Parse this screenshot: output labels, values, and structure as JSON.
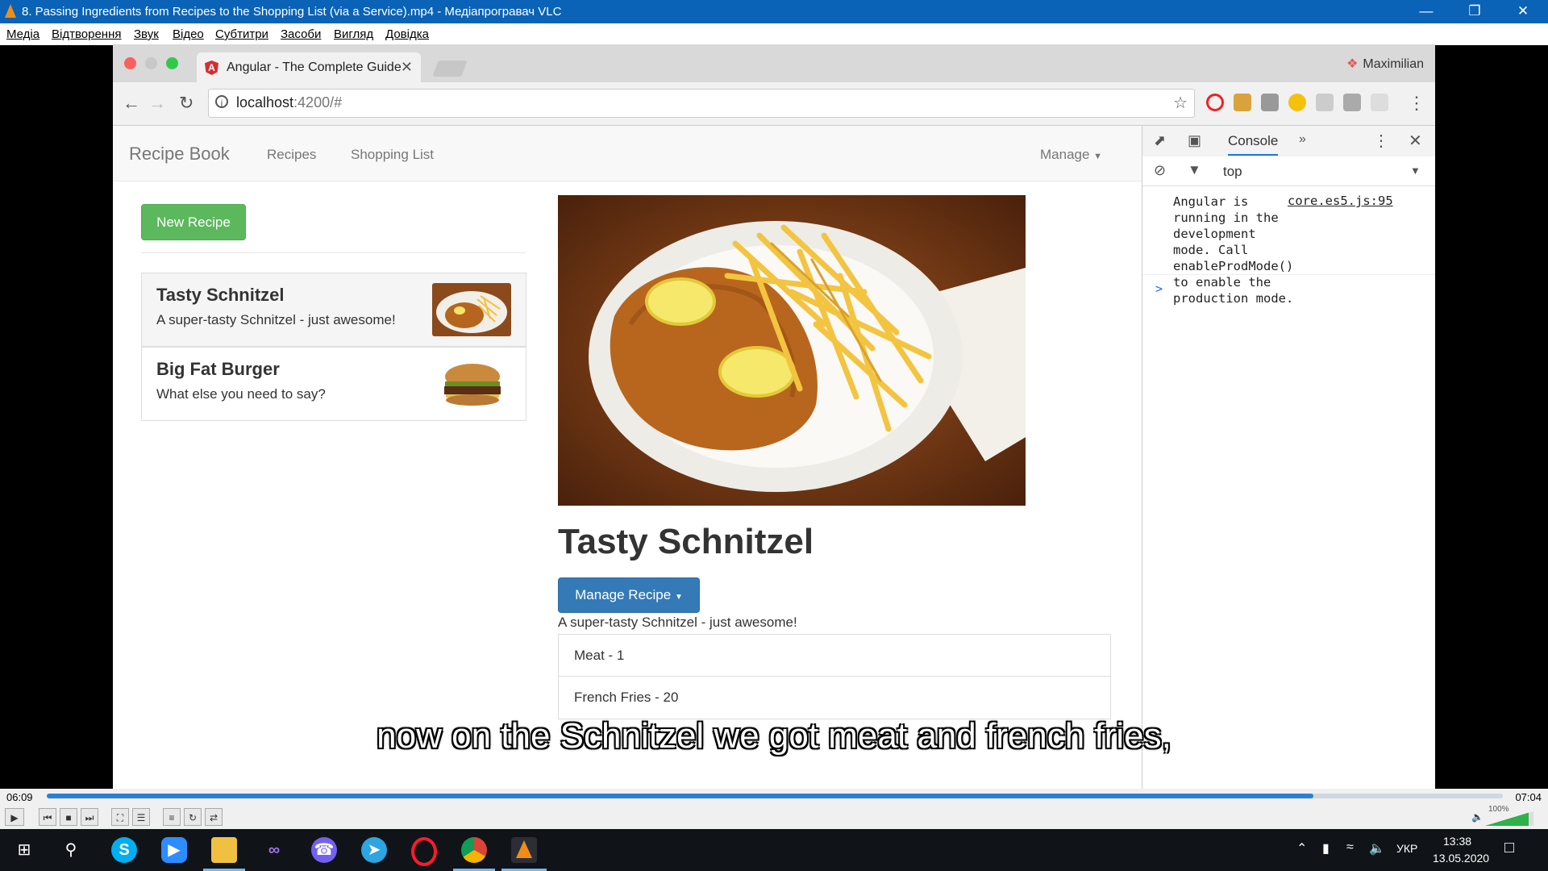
{
  "vlc": {
    "title": "8. Passing Ingredients from Recipes to the Shopping List (via a Service).mp4 - Медіапрогравач VLC",
    "menu": [
      "Медіа",
      "Відтворення",
      "Звук",
      "Відео",
      "Субтитри",
      "Засоби",
      "Вигляд",
      "Довідка"
    ],
    "time_elapsed": "06:09",
    "time_total": "07:04",
    "progress": 0.87,
    "volume": "100%",
    "subtitle": "now on the Schnitzel we got meat and french fries,"
  },
  "browser": {
    "tab_title": "Angular - The Complete Guide",
    "tab_icon": "A",
    "profile": "Maximilian",
    "url_host": "localhost",
    "url_rest": ":4200/#"
  },
  "app": {
    "brand": "Recipe Book",
    "nav": [
      "Recipes",
      "Shopping List"
    ],
    "manage": "Manage",
    "new_recipe": "New Recipe",
    "recipes": [
      {
        "name": "Tasty Schnitzel",
        "desc": "A super-tasty Schnitzel - just awesome!"
      },
      {
        "name": "Big Fat Burger",
        "desc": "What else you need to say?"
      }
    ],
    "detail": {
      "title": "Tasty Schnitzel",
      "manage_btn": "Manage Recipe",
      "desc": "A super-tasty Schnitzel - just awesome!",
      "ingredients": [
        "Meat - 1",
        "French Fries - 20"
      ]
    }
  },
  "devtools": {
    "tab": "Console",
    "context": "top",
    "log_text": "Angular is running in the development mode. Call enableProdMode() to enable the production mode.",
    "log_source": "core.es5.js:95",
    "prompt": ">"
  },
  "taskbar": {
    "lang": "УКР",
    "time": "13:38",
    "date": "13.05.2020"
  },
  "colors": {
    "vlc_title": "#0a63b6",
    "success": "#5cb85c",
    "primary": "#337ab7",
    "seek": "#2a7fd8"
  }
}
